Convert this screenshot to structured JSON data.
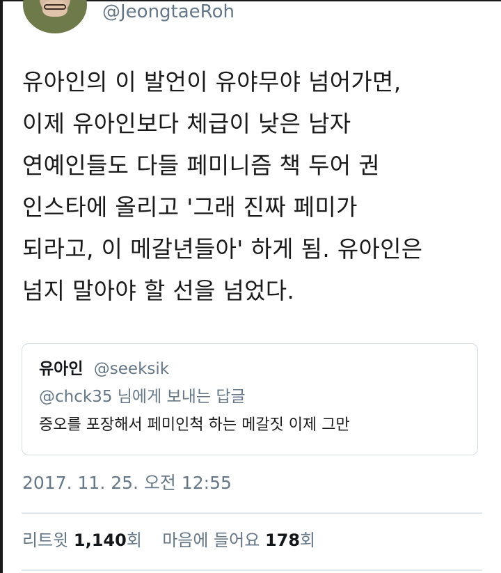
{
  "author": {
    "handle": "@JeongtaeRoh"
  },
  "tweet": {
    "text": "유아인의 이 발언이 유야무야 넘어가면,\n이제 유아인보다 체급이 낮은 남자\n연예인들도 다들 페미니즘 책 두어 권\n인스타에 올리고 '그래 진짜 페미가\n되라고, 이 메갈년들아' 하게 됨. 유아인은\n넘지 말아야 할 선을 넘었다."
  },
  "quoted_tweet": {
    "name": "유아인",
    "handle": "@seeksik",
    "reply_to": "@chck35 님에게 보내는 답글",
    "text": "증오를 포장해서 페미인척 하는 메갈짓 이제 그만"
  },
  "timestamp": "2017. 11. 25. 오전 12:55",
  "stats": {
    "retweets_label": "리트윗",
    "retweets_count": "1,140",
    "retweets_unit": "회",
    "likes_label": "마음에 들어요",
    "likes_count": "178",
    "likes_unit": "회"
  }
}
